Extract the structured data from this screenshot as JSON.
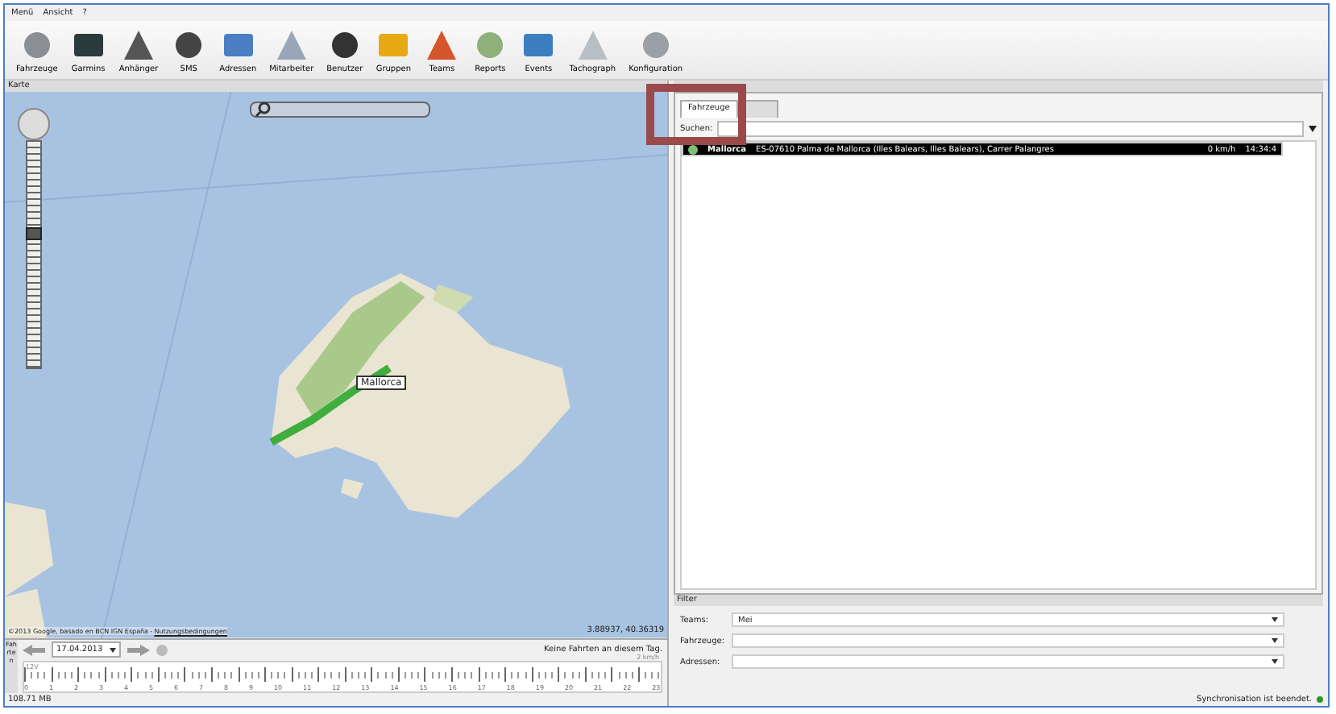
{
  "menu": [
    "Menü",
    "Ansicht",
    "?"
  ],
  "toolbar": [
    {
      "label": "Fahrzeuge"
    },
    {
      "label": "Garmins"
    },
    {
      "label": "Anhänger"
    },
    {
      "label": "SMS"
    },
    {
      "label": "Adressen"
    },
    {
      "label": "Mitarbeiter"
    },
    {
      "label": "Benutzer"
    },
    {
      "label": "Gruppen"
    },
    {
      "label": "Teams"
    },
    {
      "label": "Reports"
    },
    {
      "label": "Events"
    },
    {
      "label": "Tachograph"
    },
    {
      "label": "Konfiguration"
    }
  ],
  "map_panel": {
    "title": "Karte",
    "copyright": "©2013 Google, basado en BCN IGN España - ",
    "terms_link": "Nutzungsbedingungen",
    "coordinates": "3.88937, 40.36319",
    "marker_label": "Mallorca"
  },
  "timeline": {
    "side_label": "Fahrten",
    "date": "17.04.2013",
    "message": "Keine Fahrten an diesem Tag.",
    "speed_label": "2 km/h",
    "voltage_label": "12V",
    "hours": [
      "0",
      "1",
      "2",
      "3",
      "4",
      "5",
      "6",
      "7",
      "8",
      "9",
      "10",
      "11",
      "12",
      "13",
      "14",
      "15",
      "16",
      "17",
      "18",
      "19",
      "20",
      "21",
      "22",
      "23"
    ]
  },
  "memory": "108.71 MB",
  "zoom": {
    "level": 0.6
  },
  "tabs": [
    {
      "label": "Fahrzeuge",
      "selected": true
    },
    {
      "selected": false
    }
  ],
  "search": {
    "label": "Suchen:"
  },
  "vehicles": [
    {
      "name": "Mallorca",
      "address": "ES-07610 Palma de Mallorca (Illes Balears, Illes Balears), Carrer Palangres",
      "speed": "0 km/h",
      "time": "14:34:4",
      "selected": true
    }
  ],
  "filter": {
    "title": "Filter",
    "fields": [
      {
        "label": "Teams:",
        "value": "Mei"
      },
      {
        "label": "Fahrzeuge:"
      },
      {
        "label": "Adressen:"
      }
    ]
  },
  "status": {
    "text": "Synchronisation ist beendet.",
    "color": "#2a9a2a"
  }
}
